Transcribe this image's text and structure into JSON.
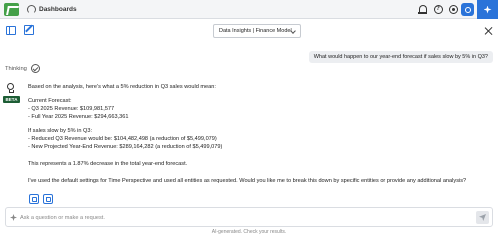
{
  "topbar": {
    "tab_label": "Dashboards",
    "tab_close": "×"
  },
  "toolbar": {
    "model_selected": "Data Insights | Finance Model"
  },
  "conversation": {
    "user_message": "What would happen to our year-end forecast if sales slow by 5% in Q3?",
    "thinking_label": "Thinking",
    "beta_badge": "BETA",
    "answer": {
      "intro": "Based on the analysis, here's what a 5% reduction in Q3 sales would mean:",
      "current_heading": "Current Forecast:",
      "current_q3": "- Q3 2025 Revenue: $109,981,577",
      "current_full_year": "- Full Year 2025 Revenue: $294,663,361",
      "scenario_heading": "If sales slow by 5% in Q3:",
      "scenario_q3": "- Reduced Q3 Revenue would be: $104,482,498 (a reduction of $5,499,079)",
      "scenario_year_end": "- New Projected Year-End Revenue: $289,164,282 (a reduction of $5,499,079)",
      "summary": "This represents a 1.87% decrease in the total year-end forecast.",
      "followup": "I've used the default settings for Time Perspective and used all entities as requested. Would you like me to break this down by specific entities or provide any additional analysis?"
    }
  },
  "composer": {
    "placeholder": "Ask a question or make a request.",
    "disclaimer": "AI-generated. Check your results."
  },
  "colors": {
    "accent": "#2a73d9",
    "brand": "#44a049",
    "beta": "#1d5d35"
  }
}
